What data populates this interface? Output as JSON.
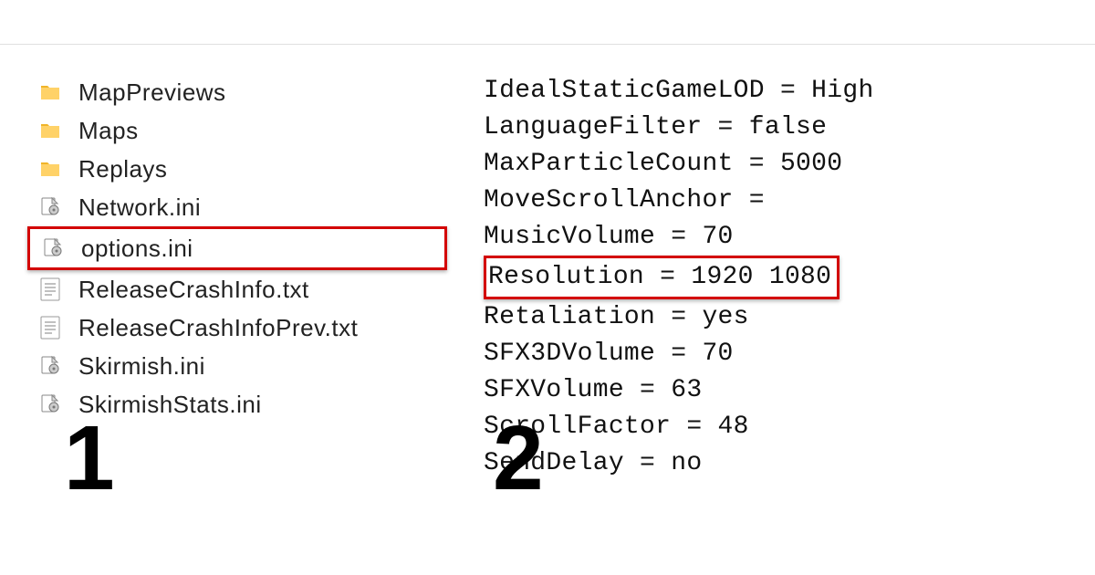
{
  "files": [
    {
      "name": "MapPreviews",
      "type": "folder",
      "highlighted": false
    },
    {
      "name": "Maps",
      "type": "folder",
      "highlighted": false
    },
    {
      "name": "Replays",
      "type": "folder",
      "highlighted": false
    },
    {
      "name": "Network.ini",
      "type": "ini",
      "highlighted": false
    },
    {
      "name": "options.ini",
      "type": "ini",
      "highlighted": true
    },
    {
      "name": "ReleaseCrashInfo.txt",
      "type": "txt",
      "highlighted": false
    },
    {
      "name": "ReleaseCrashInfoPrev.txt",
      "type": "txt",
      "highlighted": false
    },
    {
      "name": "Skirmish.ini",
      "type": "ini",
      "highlighted": false
    },
    {
      "name": "SkirmishStats.ini",
      "type": "ini",
      "highlighted": false
    }
  ],
  "config_lines": [
    {
      "text": "IdealStaticGameLOD = High",
      "highlighted": false
    },
    {
      "text": "LanguageFilter = false",
      "highlighted": false
    },
    {
      "text": "MaxParticleCount = 5000",
      "highlighted": false
    },
    {
      "text": "MoveScrollAnchor =",
      "highlighted": false
    },
    {
      "text": "MusicVolume = 70",
      "highlighted": false
    },
    {
      "text": "Resolution = 1920 1080",
      "highlighted": true
    },
    {
      "text": "Retaliation = yes",
      "highlighted": false
    },
    {
      "text": "SFX3DVolume = 70",
      "highlighted": false
    },
    {
      "text": "SFXVolume = 63",
      "highlighted": false
    },
    {
      "text": "ScrollFactor = 48",
      "highlighted": false
    },
    {
      "text": "SendDelay = no",
      "highlighted": false
    }
  ],
  "step_labels": {
    "one": "1",
    "two": "2"
  }
}
